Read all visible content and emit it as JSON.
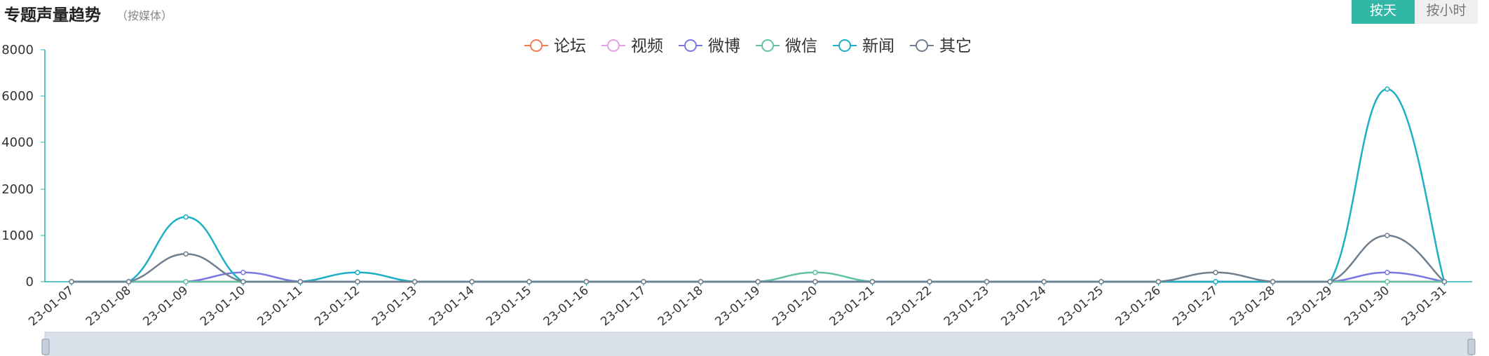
{
  "header": {
    "title": "专题声量趋势",
    "subtitle": "（按媒体）",
    "btn_day": "按天",
    "btn_hour": "按小时"
  },
  "colors": {
    "论坛": "#f07c4f",
    "视频": "#e5a0e3",
    "微博": "#7a78e0",
    "微信": "#62c2a0",
    "新闻": "#1db0c4",
    "其它": "#6f7f8e",
    "axis": "#23b0b0",
    "accent": "#32b7a6"
  },
  "chart_data": {
    "type": "line",
    "smooth": true,
    "legend_position": "top-center",
    "grid": false,
    "ylim": [
      0,
      8000
    ],
    "yticks": [
      "0",
      "1000",
      "2000",
      "4000",
      "6000",
      "8000"
    ],
    "categories": [
      "23-01-07",
      "23-01-08",
      "23-01-09",
      "23-01-10",
      "23-01-11",
      "23-01-12",
      "23-01-13",
      "23-01-14",
      "23-01-15",
      "23-01-16",
      "23-01-17",
      "23-01-18",
      "23-01-19",
      "23-01-20",
      "23-01-21",
      "23-01-22",
      "23-01-23",
      "23-01-24",
      "23-01-25",
      "23-01-26",
      "23-01-27",
      "23-01-28",
      "23-01-29",
      "23-01-30",
      "23-01-31"
    ],
    "series": [
      {
        "name": "论坛",
        "values": [
          0,
          0,
          0,
          0,
          0,
          0,
          0,
          0,
          0,
          0,
          0,
          0,
          0,
          0,
          0,
          0,
          0,
          0,
          0,
          0,
          0,
          0,
          0,
          0,
          0
        ]
      },
      {
        "name": "视频",
        "values": [
          0,
          0,
          0,
          0,
          0,
          0,
          0,
          0,
          0,
          0,
          0,
          0,
          0,
          0,
          0,
          0,
          0,
          0,
          0,
          0,
          0,
          0,
          0,
          0,
          0
        ]
      },
      {
        "name": "微博",
        "values": [
          0,
          0,
          0,
          200,
          0,
          0,
          0,
          0,
          0,
          0,
          0,
          0,
          0,
          0,
          0,
          0,
          0,
          0,
          0,
          0,
          0,
          0,
          0,
          200,
          0
        ]
      },
      {
        "name": "微信",
        "values": [
          0,
          0,
          0,
          0,
          0,
          0,
          0,
          0,
          0,
          0,
          0,
          0,
          0,
          200,
          0,
          0,
          0,
          0,
          0,
          0,
          0,
          0,
          0,
          0,
          0
        ]
      },
      {
        "name": "新闻",
        "values": [
          0,
          0,
          1400,
          0,
          0,
          200,
          0,
          0,
          0,
          0,
          0,
          0,
          0,
          0,
          0,
          0,
          0,
          0,
          0,
          0,
          0,
          0,
          0,
          6300,
          0
        ]
      },
      {
        "name": "其它",
        "values": [
          0,
          0,
          600,
          0,
          0,
          0,
          0,
          0,
          0,
          0,
          0,
          0,
          0,
          0,
          0,
          0,
          0,
          0,
          0,
          0,
          200,
          0,
          0,
          1000,
          0
        ]
      }
    ]
  }
}
